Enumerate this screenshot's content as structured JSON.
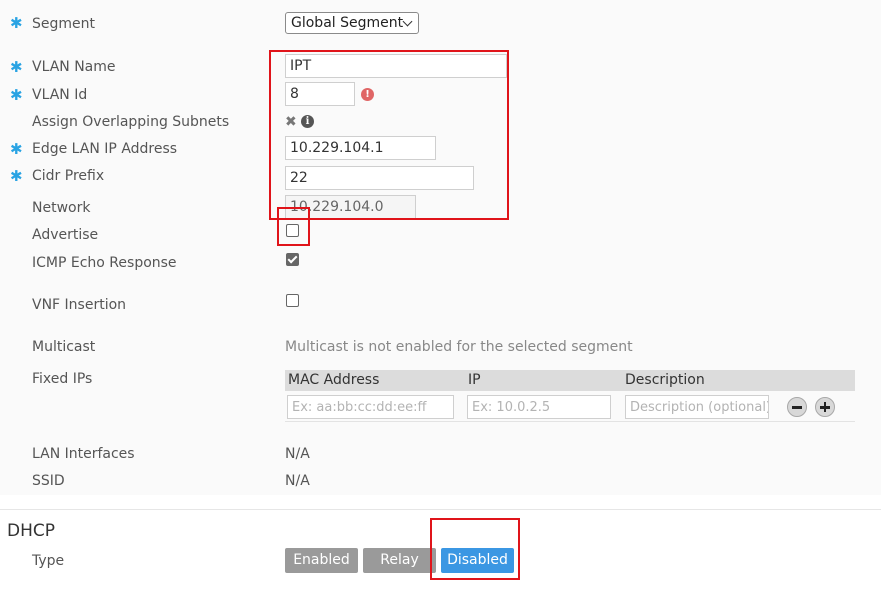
{
  "form": {
    "segment": {
      "label": "Segment",
      "value": "Global Segment"
    },
    "vlan_name": {
      "label": "VLAN Name",
      "value": "IPT"
    },
    "vlan_id": {
      "label": "VLAN Id",
      "value": "8",
      "error_icon": "!"
    },
    "assign_overlapping": {
      "label": "Assign Overlapping Subnets"
    },
    "edge_lan_ip": {
      "label": "Edge LAN IP Address",
      "value": "10.229.104.1"
    },
    "cidr_prefix": {
      "label": "Cidr Prefix",
      "value": "22"
    },
    "network": {
      "label": "Network",
      "value": "10.229.104.0"
    },
    "advertise": {
      "label": "Advertise",
      "checked": false
    },
    "icmp_echo": {
      "label": "ICMP Echo Response",
      "checked": true
    },
    "vnf_insertion": {
      "label": "VNF Insertion",
      "checked": false
    },
    "multicast": {
      "label": "Multicast",
      "value": "Multicast is not enabled for the selected segment"
    },
    "fixed_ips": {
      "label": "Fixed IPs",
      "columns": [
        "MAC Address",
        "IP",
        "Description"
      ],
      "placeholders": {
        "mac": "Ex: aa:bb:cc:dd:ee:ff",
        "ip": "Ex: 10.0.2.5",
        "description": "Description (optional)"
      }
    },
    "lan_interfaces": {
      "label": "LAN Interfaces",
      "value": "N/A"
    },
    "ssid": {
      "label": "SSID",
      "value": "N/A"
    }
  },
  "dhcp": {
    "title": "DHCP",
    "type_label": "Type",
    "options": [
      "Enabled",
      "Relay",
      "Disabled"
    ],
    "selected": "Disabled"
  },
  "required_marker": "✱",
  "colors": {
    "accent": "#3b97e3",
    "required": "#29a3e3",
    "highlight": "#e0141a",
    "error": "#e06666"
  },
  "icons": [
    "required-asterisk-icon",
    "chevron-down-icon",
    "error-icon",
    "close-icon",
    "info-icon",
    "remove-row-icon",
    "add-row-icon"
  ]
}
